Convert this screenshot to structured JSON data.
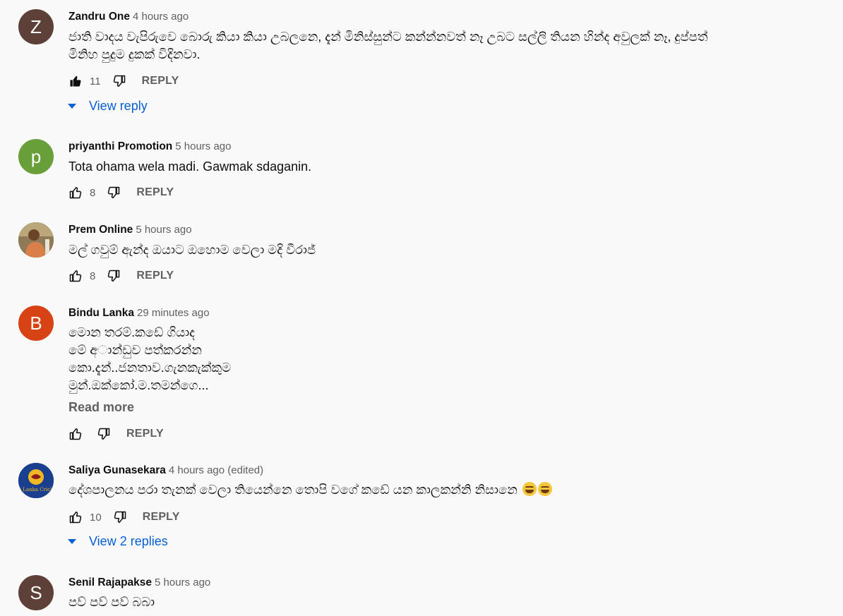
{
  "comments": [
    {
      "avatar_letter": "Z",
      "avatar_color": "#5d4037",
      "author": "Zandru One",
      "time": "4 hours ago",
      "text": "ජාති වාදය වැපිරුවෙ බොරු කියා කියා උබලනෙ, දැන් මිනිස්සුන්ට කන්න්නවත් නෑ උබට සල්ලි තියන හින්ද අවුලක් නෑ, දුප්පත්\nමිනිහ පුදුම දුකක් විදිනවා.",
      "likes": "11",
      "liked": true,
      "reply_label": "REPLY",
      "view_replies": "View reply"
    },
    {
      "avatar_letter": "p",
      "avatar_color": "#689f38",
      "author": "priyanthi Promotion",
      "time": "5 hours ago",
      "text": "Tota ohama wela madi. Gawmak sdaganin.",
      "likes": "8",
      "reply_label": "REPLY"
    },
    {
      "avatar_letter": "",
      "avatar_color": "#c9a36e",
      "author": "Prem Online",
      "time": "5 hours ago",
      "text": "මල් ගවුම් ඇන්ද ඔයාට ඔහොම වෙලා මදි වීරාජ්",
      "likes": "8",
      "reply_label": "REPLY"
    },
    {
      "avatar_letter": "B",
      "avatar_color": "#d84315",
      "author": "Bindu Lanka",
      "time": "29 minutes ago",
      "text": "මොන තරම්.කඩේ ගියාද\nමේ අ◌ාන්ඩුව පත්කරන්න\nකො.දැන්..ජනතාව.ගැනකැක්කුම\nමුන්.ඔක්කෝ.ම.තමන්ගෙ...",
      "read_more": "Read more",
      "likes": "",
      "reply_label": "REPLY"
    },
    {
      "avatar_letter": "",
      "avatar_color": "#1a3f8f",
      "avatar_logo_text": "Sri Lanka Cricket",
      "author": "Saliya Gunasekara",
      "time": "4 hours ago (edited)",
      "text": "දේශපාලනය පරා තැනක් වෙලා තියෙන්නෙ තොපි වගේ කඩේ යන කාලකන්නි නිසානෙ",
      "likes": "10",
      "reply_label": "REPLY",
      "view_replies": "View 2 replies"
    },
    {
      "avatar_letter": "S",
      "avatar_color": "#5d4037",
      "author": "Senil Rajapakse",
      "time": "5 hours ago",
      "text": "පව් පව් පව් බබා"
    }
  ]
}
